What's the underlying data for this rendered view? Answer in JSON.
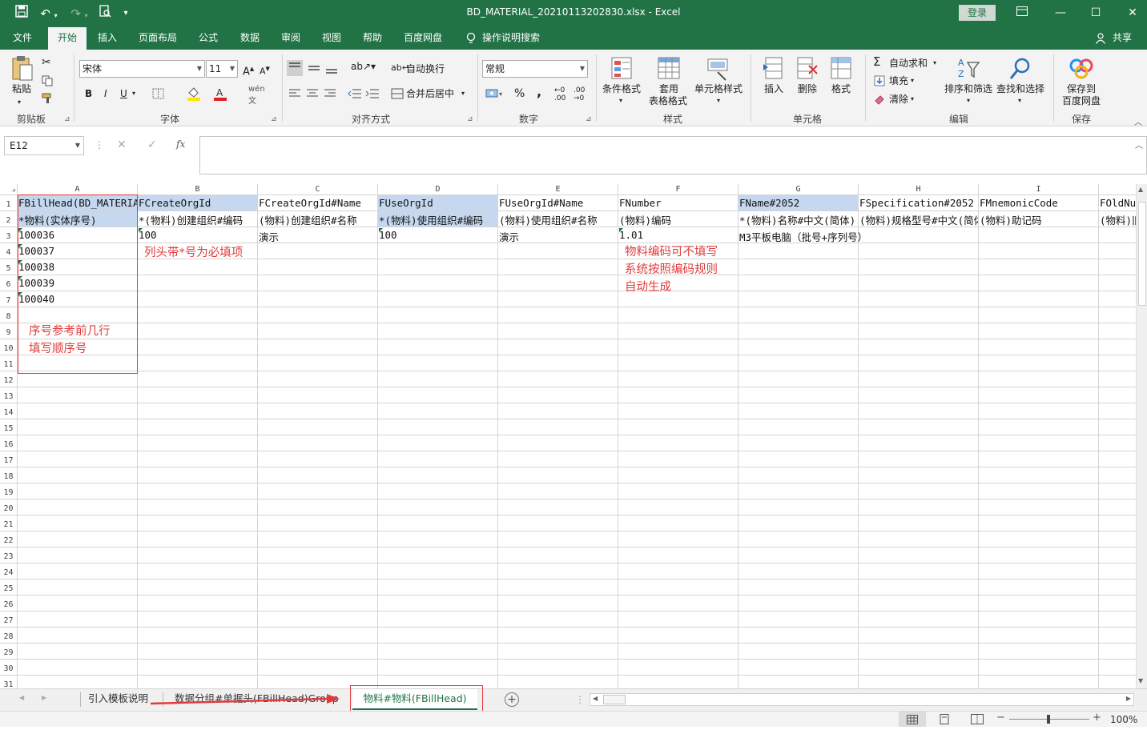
{
  "titlebar": {
    "document_title": "BD_MATERIAL_20210113202830.xlsx - Excel",
    "login_label": "登录",
    "quick_access": [
      "save-icon",
      "undo-icon",
      "redo-icon",
      "print-preview-icon",
      "customize-icon"
    ]
  },
  "menu": {
    "tabs": [
      "文件",
      "开始",
      "插入",
      "页面布局",
      "公式",
      "数据",
      "审阅",
      "视图",
      "帮助",
      "百度网盘"
    ],
    "active_tab": "开始",
    "search_label": "操作说明搜索",
    "share_label": "共享"
  },
  "ribbon": {
    "clipboard": {
      "paste_label": "粘贴",
      "group_label": "剪贴板"
    },
    "font": {
      "font_name": "宋体",
      "font_size": "11",
      "bold": "B",
      "italic": "I",
      "underline": "U",
      "group_label": "字体"
    },
    "alignment": {
      "wrap_label": "自动换行",
      "merge_label": "合并后居中",
      "group_label": "对齐方式"
    },
    "number": {
      "format_value": "常规",
      "percent": "%",
      "comma": ",",
      "group_label": "数字"
    },
    "styles": {
      "conditional_label": "条件格式",
      "table_label_1": "套用",
      "table_label_2": "表格格式",
      "cell_style_label": "单元格样式",
      "group_label": "样式"
    },
    "cells": {
      "insert_label": "插入",
      "delete_label": "删除",
      "format_label": "格式",
      "group_label": "单元格"
    },
    "editing": {
      "autosum_label": "自动求和",
      "fill_label": "填充",
      "clear_label": "清除",
      "sort_label": "排序和筛选",
      "find_label": "查找和选择",
      "group_label": "编辑"
    },
    "save": {
      "save_label_1": "保存到",
      "save_label_2": "百度网盘",
      "group_label": "保存"
    }
  },
  "formula_bar": {
    "name_box": "E12",
    "fx_label": "fx",
    "formula": ""
  },
  "sheet": {
    "column_headers": [
      "A",
      "B",
      "C",
      "D",
      "E",
      "F",
      "G",
      "H",
      "I"
    ],
    "row_headers": [
      "1",
      "2",
      "3",
      "4",
      "5",
      "6",
      "7",
      "8",
      "9",
      "10",
      "11",
      "12",
      "13",
      "14",
      "15",
      "16",
      "17",
      "18",
      "19",
      "20",
      "21",
      "22",
      "23",
      "24",
      "25",
      "26",
      "27",
      "28",
      "29",
      "30",
      "31"
    ],
    "row1": [
      "FBillHead(BD_MATERIAL)",
      "FCreateOrgId",
      "FCreateOrgId#Name",
      "FUseOrgId",
      "FUseOrgId#Name",
      "FNumber",
      "FName#2052",
      "FSpecification#2052",
      "FMnemonicCode",
      "FOldNumber"
    ],
    "row2": [
      "*物料(实体序号)",
      "*(物料)创建组织#编码",
      "(物料)创建组织#名称",
      "*(物料)使用组织#编码",
      "(物料)使用组织#名称",
      "(物料)编码",
      "*(物料)名称#中文(简体)",
      "(物料)规格型号#中文(简体)",
      "(物料)助记码",
      "(物料)旧物料编码"
    ],
    "row3": [
      "100036",
      "100",
      "演示",
      "100",
      "演示",
      "1.01",
      "M3平板电脑（批号+序列号）"
    ],
    "col_a_rows": [
      "100037",
      "100038",
      "100039",
      "100040"
    ]
  },
  "annotations": {
    "required_note": "列头带*号为必填项",
    "number_note": [
      "物料编码可不填写",
      "系统按照编码规则",
      "自动生成"
    ],
    "seq_note": [
      "序号参考前几行",
      "填写顺序号"
    ]
  },
  "sheet_tabs": {
    "tabs": [
      "引入模板说明",
      "数据分组#单据头(FBillHead)Group",
      "物料#物料(FBillHead)"
    ],
    "active": "物料#物料(FBillHead)"
  },
  "statusbar": {
    "zoom": "100%"
  },
  "colors": {
    "accent": "#217346",
    "header_highlight": "#c5d8ef",
    "annotation_red": "#e03c3c"
  }
}
